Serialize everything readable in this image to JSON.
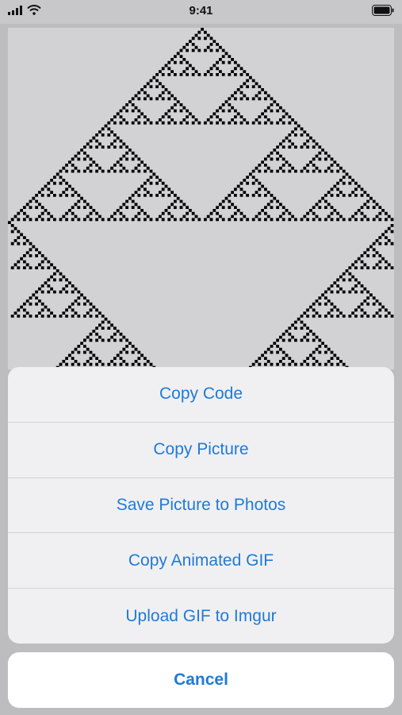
{
  "status_bar": {
    "time": "9:41",
    "signal_icon": "cellular-signal-icon",
    "wifi_icon": "wifi-icon",
    "battery_icon": "battery-icon"
  },
  "canvas": {
    "image": "sierpinski-triangle-pattern",
    "background_color": "#d2d2d4",
    "cell_color": "#000000"
  },
  "action_sheet": {
    "items": [
      {
        "label": "Copy Code"
      },
      {
        "label": "Copy Picture"
      },
      {
        "label": "Save Picture to Photos"
      },
      {
        "label": "Copy Animated GIF"
      },
      {
        "label": "Upload GIF to Imgur"
      }
    ],
    "cancel_label": "Cancel",
    "accent_color": "#1f7ad8"
  }
}
